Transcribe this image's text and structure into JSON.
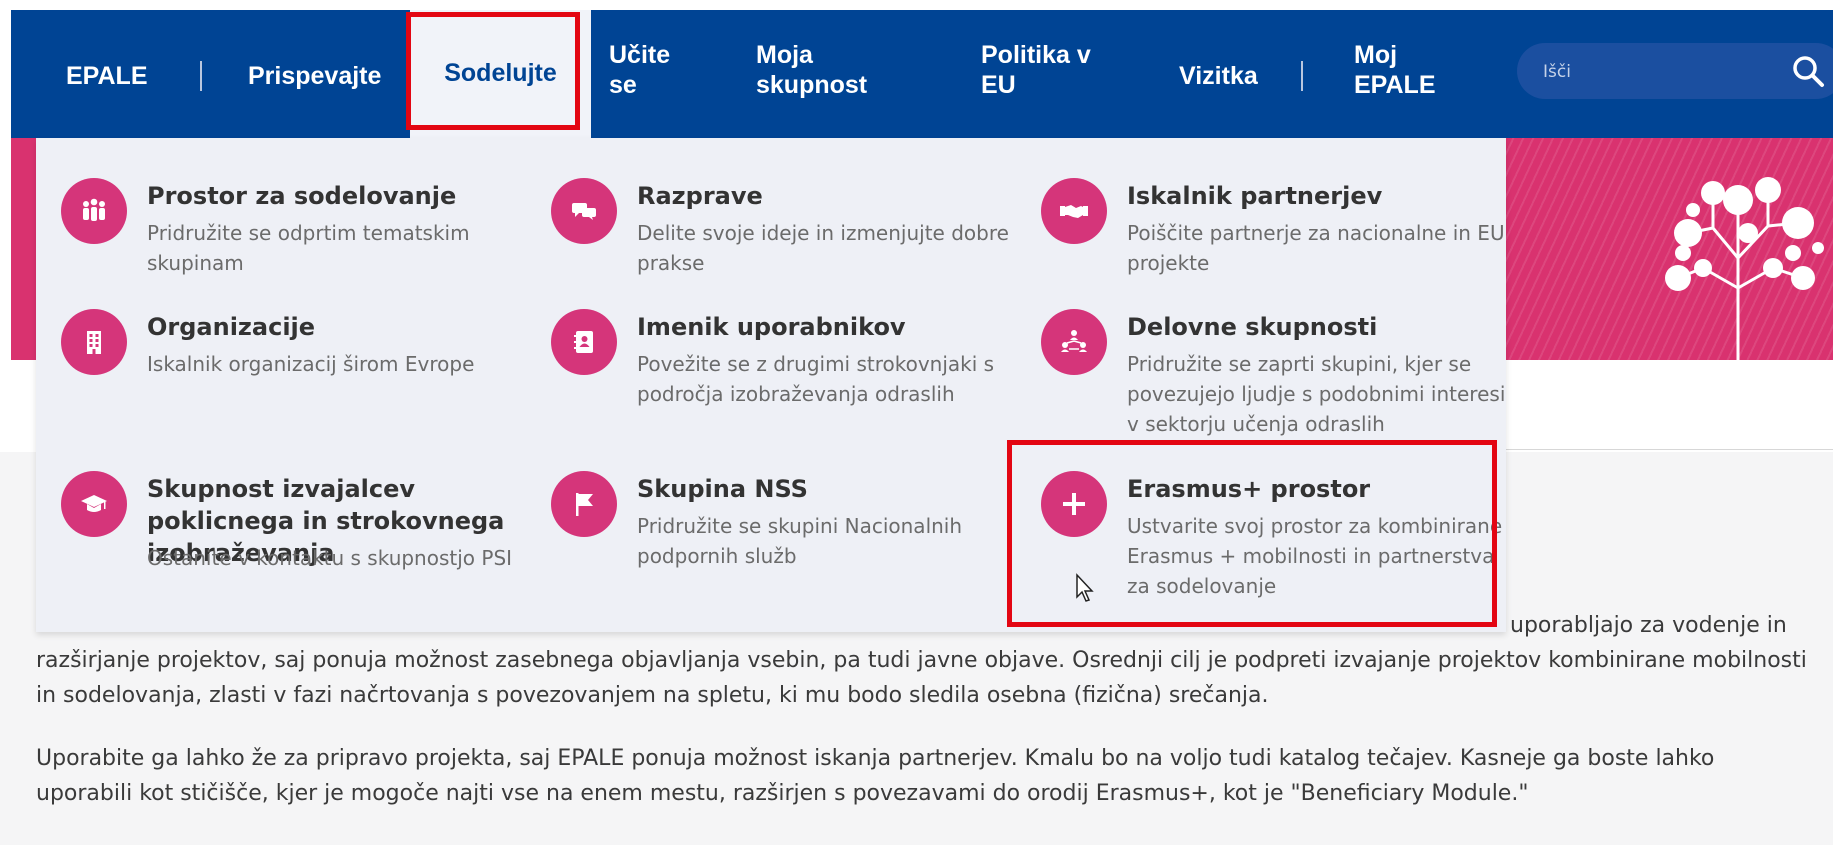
{
  "nav": {
    "items": [
      {
        "label": "EPALE"
      },
      {
        "label": "Prispevajte"
      },
      {
        "label": "Sodelujte",
        "active": true
      },
      {
        "label": "Učite\nse"
      },
      {
        "label": "Moja\nskupnost"
      },
      {
        "label": "Politika v\nEU"
      },
      {
        "label": "Vizitka"
      },
      {
        "label": "Moj\nEPALE"
      }
    ],
    "search": {
      "placeholder": "Išči",
      "icon": "search-icon"
    }
  },
  "dropdown": {
    "items": [
      {
        "title": "Prostor za sodelovanje",
        "desc": "Pridružite se odprtim tematskim skupinam",
        "icon": "people-icon"
      },
      {
        "title": "Razprave",
        "desc": "Delite svoje ideje in izmenjujte dobre prakse",
        "icon": "chat-bubbles-icon"
      },
      {
        "title": "Iskalnik partnerjev",
        "desc": "Poiščite partnerje za nacionalne in EU projekte",
        "icon": "handshake-icon"
      },
      {
        "title": "Organizacije",
        "desc": "Iskalnik organizacij širom Evrope",
        "icon": "building-icon"
      },
      {
        "title": "Imenik uporabnikov",
        "desc": "Povežite se z drugimi strokovnjaki s področja izobraževanja odraslih",
        "icon": "address-book-icon"
      },
      {
        "title": "Delovne skupnosti",
        "desc": "Pridružite se zaprti skupini, kjer se povezujejo ljudje s podobnimi interesi v sektorju učenja odraslih",
        "icon": "group-network-icon"
      },
      {
        "title": "Skupnost izvajalcev poklicnega in strokovnega izobraževanja",
        "desc": "Ostanite v kontaktu s skupnostjo PSI",
        "icon": "graduation-cap-icon"
      },
      {
        "title": "Skupina NSS",
        "desc": "Pridružite se skupini Nacionalnih podpornih služb",
        "icon": "flag-icon"
      },
      {
        "title": "Erasmus+ prostor",
        "desc": "Ustvarite svoj prostor za kombinirane Erasmus + mobilnosti in partnerstva za sodelovanje",
        "icon": "plus-icon"
      }
    ]
  },
  "content": {
    "para1_tail": "uporabljajo za vodenje in",
    "para1_rest": "razširjanje projektov, saj ponuja možnost zasebnega objavljanja vsebin, pa tudi javne objave. Osrednji cilj je podpreti izvajanje projektov kombinirane mobilnosti in sodelovanja, zlasti v fazi načrtovanja s povezovanjem na spletu, ki mu bodo sledila osebna (fizična) srečanja.",
    "para2": "Uporabite ga lahko že za pripravo projekta, saj EPALE ponuja možnost iskanja partnerjev. Kmalu bo na voljo tudi katalog tečajev. Kasneje ga boste lahko uporabili kot stičišče, kjer je mogoče najti vse na enem mestu, razširjen s povezavami do orodij Erasmus+, kot je \"Beneficiary Module.\""
  },
  "colors": {
    "nav_bg": "#004494",
    "accent": "#d5357a",
    "highlight": "#e30613"
  }
}
